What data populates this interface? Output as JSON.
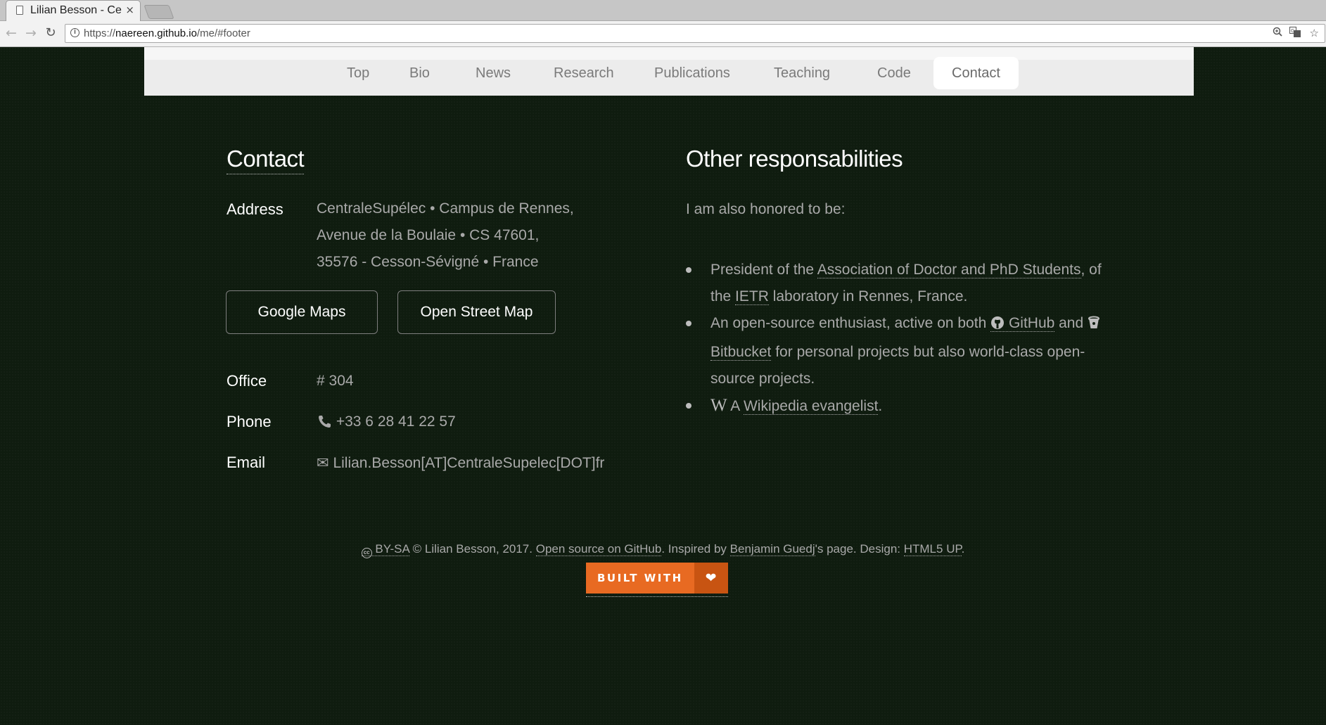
{
  "browser": {
    "tab_title": "Lilian Besson - Ce",
    "tab_close": "×",
    "url_prefix": "https://",
    "url_host": "naereen.github.io",
    "url_path": "/me/#footer"
  },
  "nav": {
    "items": [
      {
        "label": "Top"
      },
      {
        "label": "Bio"
      },
      {
        "label": "News"
      },
      {
        "label": "Research"
      },
      {
        "label": "Publications"
      },
      {
        "label": "Teaching"
      },
      {
        "label": "Code"
      },
      {
        "label": "Contact",
        "active": true
      }
    ]
  },
  "contact": {
    "heading": "Contact",
    "address_label": "Address",
    "address_lines": [
      "CentraleSupélec • Campus de Rennes,",
      "Avenue de la Boulaie • CS 47601,",
      "35576 - Cesson-Sévigné • France"
    ],
    "buttons": {
      "google_maps": "Google Maps",
      "osm": "Open Street Map"
    },
    "office_label": "Office",
    "office_value": "# 304",
    "phone_label": "Phone",
    "phone_value": "+33 6 28 41 22 57",
    "email_label": "Email",
    "email_value": "Lilian.Besson[AT]CentraleSupelec[DOT]fr"
  },
  "other": {
    "heading": "Other responsabilities",
    "intro": "I am also honored to be:",
    "item1": {
      "pre": "President of the ",
      "link1": "Association of Doctor and PhD Students",
      "mid1": ", of the ",
      "link2": "IETR",
      "post": " laboratory in Rennes, France."
    },
    "item2": {
      "pre": "An open-source enthusiast, active on both ",
      "github": "GitHub",
      "and": " and ",
      "bitbucket": "Bitbucket",
      "post": " for personal projects but also world-class open-source projects."
    },
    "item3": {
      "pre": " A ",
      "link": "Wikipedia evangelist",
      "post": "."
    }
  },
  "footer": {
    "license": "BY-SA",
    "copyright": " © Lilian Besson, 2017. ",
    "github_link": "Open source on GitHub",
    "inspired": ". Inspired by ",
    "guedj_link": "Benjamin Guedj",
    "design": "'s page. Design: ",
    "html5up_link": "HTML5 UP",
    "end": ".",
    "badge_text": "BUILT WITH",
    "badge_icon": "heart-icon"
  }
}
